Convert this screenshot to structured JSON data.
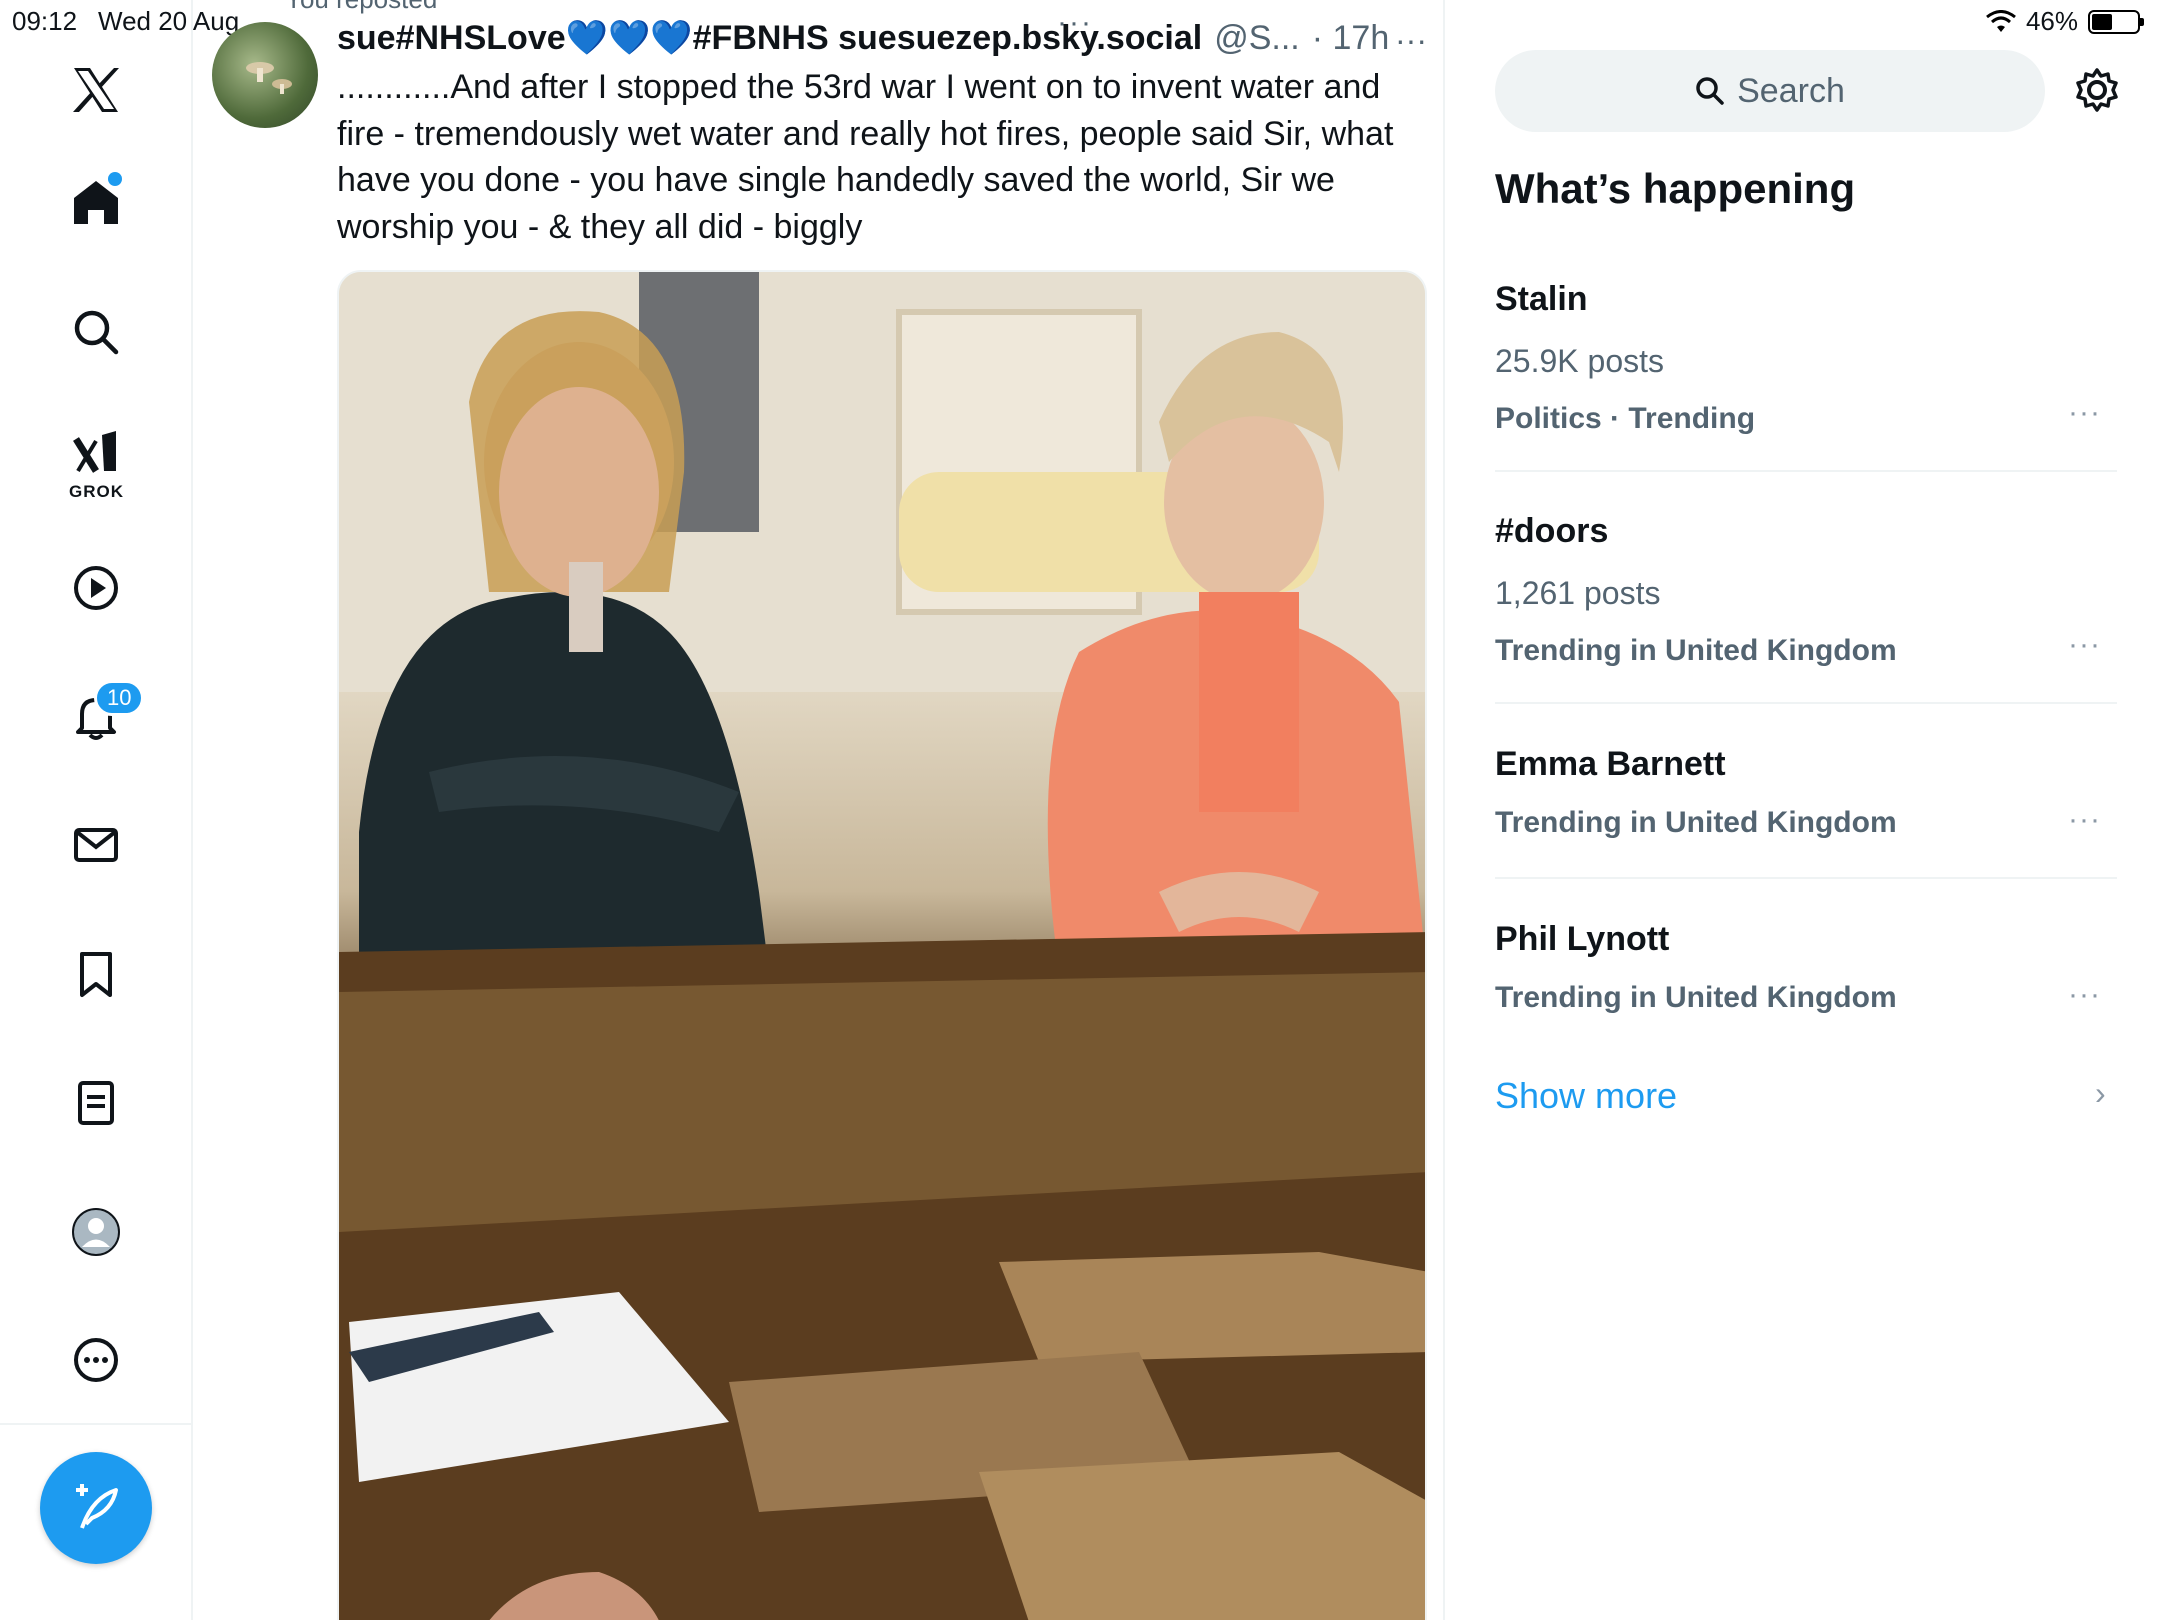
{
  "status_bar": {
    "time": "09:12",
    "date": "Wed 20 Aug",
    "battery": "46%",
    "battery_level": 0.46
  },
  "nav": {
    "items": [
      {
        "name": "x-logo"
      },
      {
        "name": "home",
        "has_dot": true
      },
      {
        "name": "search"
      },
      {
        "name": "grok",
        "label": "GROK"
      },
      {
        "name": "video"
      },
      {
        "name": "notifications",
        "badge": "10"
      },
      {
        "name": "messages"
      },
      {
        "name": "bookmarks"
      },
      {
        "name": "lists"
      },
      {
        "name": "profile"
      },
      {
        "name": "more"
      }
    ],
    "compose": "compose-post"
  },
  "tweet": {
    "repost_label": "You reposted",
    "display_name": "sue#NHSLove💙💙💙#FBNHS suesuezep.bsky.social",
    "handle": "@S...",
    "time": "· 17h",
    "more": "···",
    "text": "............And after I stopped the 53rd war I went on to invent water and fire - tremendously wet water and really hot fires,  people said Sir, what have you done - you have single handedly saved the world, Sir we worship you - & they all did - biggly"
  },
  "sidebar": {
    "search_placeholder": "Search",
    "section_title": "What’s happening",
    "trends": [
      {
        "title": "Stalin",
        "count": "25.9K posts",
        "context": "Politics · Trending"
      },
      {
        "title": "#doors",
        "count": "1,261 posts",
        "context": "Trending in United Kingdom"
      },
      {
        "title": "Emma Barnett",
        "count": "",
        "context": "Trending in United Kingdom"
      },
      {
        "title": "Phil Lynott",
        "count": "",
        "context": "Trending in United Kingdom"
      }
    ],
    "more_glyph": "···",
    "show_more": "Show more",
    "chevron": "›"
  },
  "colors": {
    "accent": "#1d9bf0",
    "text": "#0f1419",
    "muted": "#536471",
    "border": "#eff3f4"
  }
}
